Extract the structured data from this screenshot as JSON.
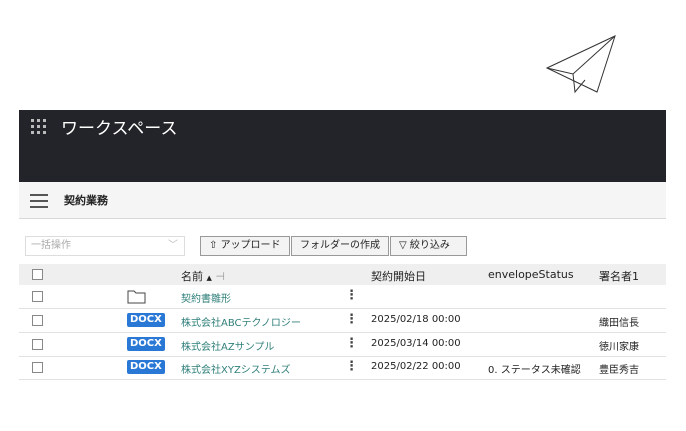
{
  "header": {
    "title": "ワークスペース",
    "apps_icon": "grid-icon"
  },
  "subheader": {
    "title": "契約業務",
    "menu_icon": "hamburger-icon"
  },
  "toolbar": {
    "bulk_placeholder": "一括操作",
    "upload": "アップロード",
    "create_folder": "フォルダーの作成",
    "filter": "絞り込み"
  },
  "table": {
    "columns": {
      "name": "名前",
      "start_date": "契約開始日",
      "status": "envelopeStatus",
      "signer": "署名者1"
    },
    "sort": "ascending",
    "rows": [
      {
        "type": "folder",
        "name": "契約書雛形",
        "date": "",
        "status": "",
        "signer": ""
      },
      {
        "type": "DOCX",
        "name": "株式会社ABCテクノロジー",
        "date": "2025/02/18 00:00",
        "status": "",
        "signer": "織田信長"
      },
      {
        "type": "DOCX",
        "name": "株式会社AZサンプル",
        "date": "2025/03/14 00:00",
        "status": "",
        "signer": "徳川家康"
      },
      {
        "type": "DOCX",
        "name": "株式会社XYZシステムズ",
        "date": "2025/02/22 00:00",
        "status": "0. ステータス未確認",
        "signer": "豊臣秀吉"
      }
    ]
  }
}
